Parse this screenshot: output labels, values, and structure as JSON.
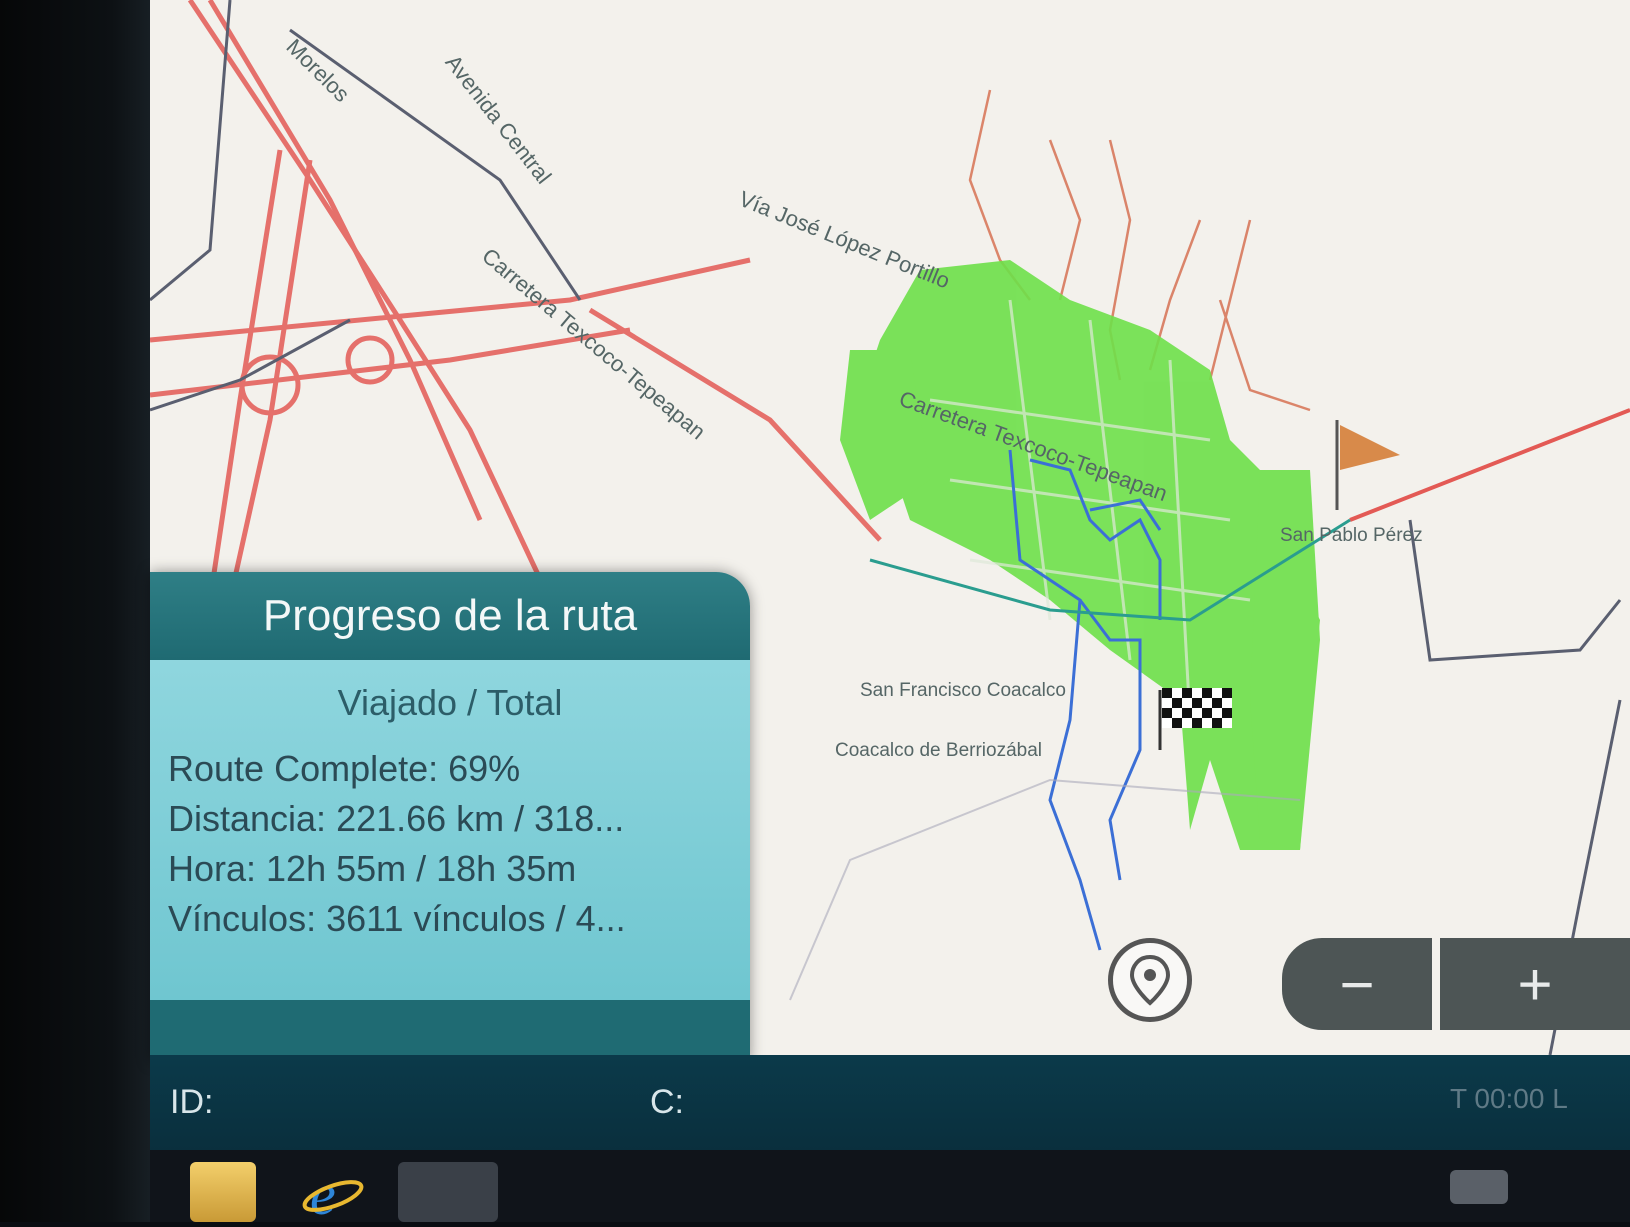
{
  "map": {
    "road_labels": [
      "Morelos",
      "Avenida Central",
      "Vía José López Portillo",
      "Carretera Texcoco-Tepeapan",
      "Carretera Texcoco-Tepeapan",
      "San Francisco Coacalco",
      "Coacalco de Berriozábal",
      "San Pablo Pérez"
    ]
  },
  "route_progress": {
    "title": "Progreso de la ruta",
    "subtitle": "Viajado / Total",
    "route_complete": "Route Complete: 69%",
    "distance": "Distancia: 221.66 km / 318...",
    "time": "Hora: 12h 55m / 18h 35m",
    "links": "Vínculos: 3611 vínculos / 4..."
  },
  "zoom": {
    "minus": "−",
    "plus": "+"
  },
  "status_bar": {
    "id_label": "ID:",
    "c_label": "C:",
    "clock": "T 00:00 L"
  },
  "colors": {
    "header": "#1f6a72",
    "panel": "#7dcfd8",
    "route_green": "#6ee04a",
    "road_red": "#e35a55",
    "road_blue": "#3b6fd6"
  },
  "icons": [
    "folder-icon",
    "ie-browser-icon",
    "app-icon",
    "keyboard-icon",
    "location-pin-icon",
    "start-flag-icon",
    "finish-flag-icon"
  ]
}
